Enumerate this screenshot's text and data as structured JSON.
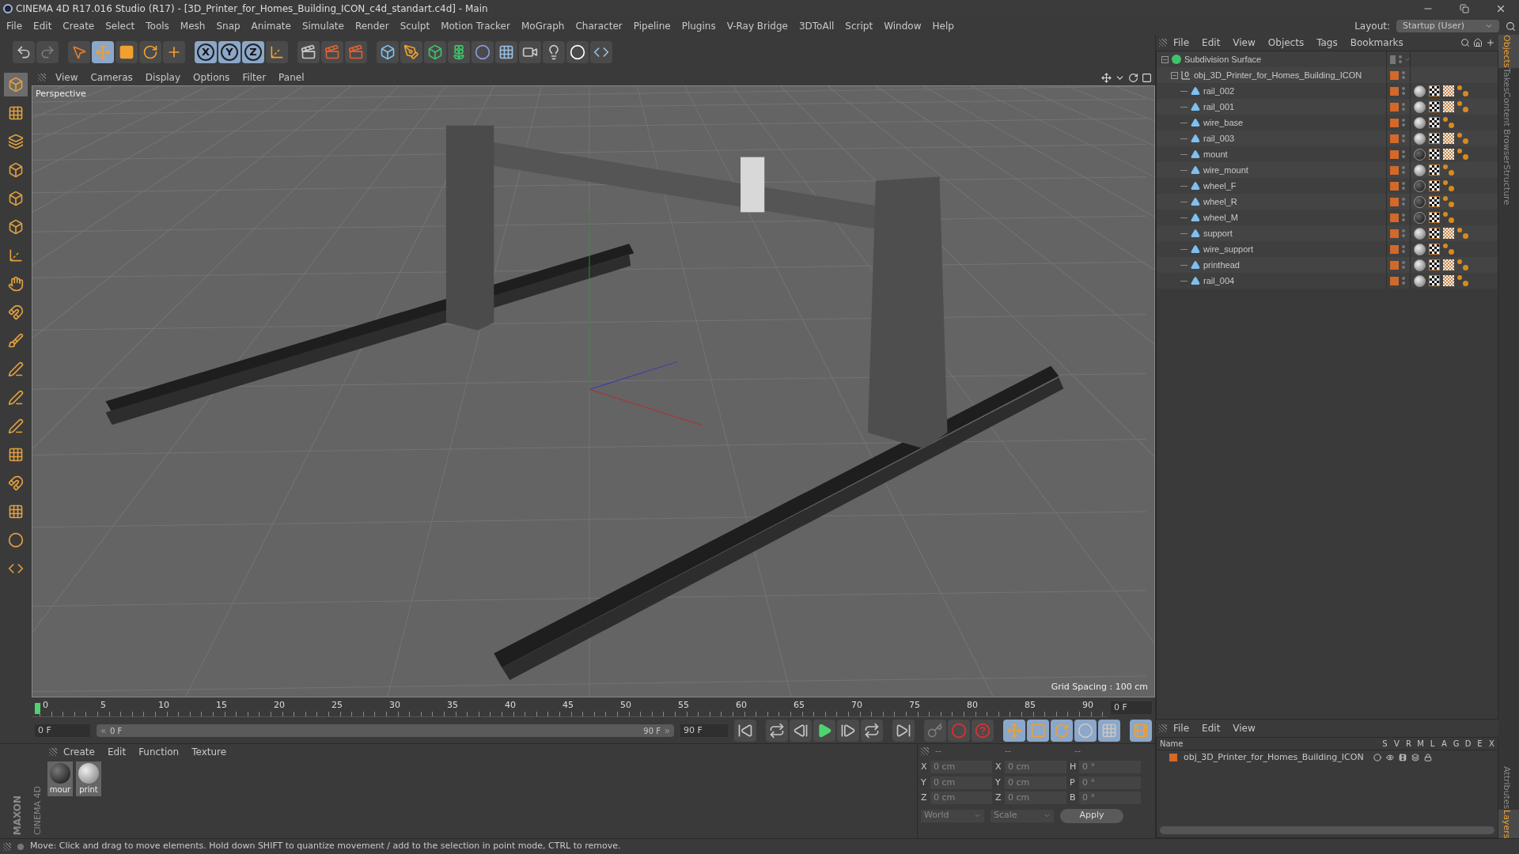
{
  "window": {
    "title": "CINEMA 4D R17.016 Studio (R17) - [3D_Printer_for_Homes_Building_ICON_c4d_standart.c4d] - Main"
  },
  "menu": [
    "File",
    "Edit",
    "Create",
    "Select",
    "Tools",
    "Mesh",
    "Snap",
    "Animate",
    "Simulate",
    "Render",
    "Sculpt",
    "Motion Tracker",
    "MoGraph",
    "Character",
    "Pipeline",
    "Plugins",
    "V-Ray Bridge",
    "3DToAll",
    "Script",
    "Window",
    "Help"
  ],
  "layout": {
    "label": "Layout:",
    "value": "Startup (User)"
  },
  "toolbar": {
    "axes": [
      {
        "label": "X",
        "selected": true
      },
      {
        "label": "Y",
        "selected": true
      },
      {
        "label": "Z",
        "selected": true
      }
    ],
    "move_selected": true
  },
  "viewport": {
    "menu": [
      "View",
      "Cameras",
      "Display",
      "Options",
      "Filter",
      "Panel"
    ],
    "camera": "Perspective",
    "grid_spacing": "Grid Spacing : 100 cm"
  },
  "timeline": {
    "ruler": [
      "0",
      "5",
      "10",
      "15",
      "20",
      "25",
      "30",
      "35",
      "40",
      "45",
      "50",
      "55",
      "60",
      "65",
      "70",
      "75",
      "80",
      "85",
      "90"
    ],
    "current": "0 F",
    "start": "0 F",
    "range_start": "0 F",
    "range_end": "90 F",
    "end": "90 F",
    "range_slider": {
      "level": 1
    }
  },
  "materials": {
    "menu": [
      "Create",
      "Edit",
      "Function",
      "Texture"
    ],
    "items": [
      {
        "label": "mour",
        "dark": true
      },
      {
        "label": "print",
        "dark": false
      }
    ]
  },
  "logo": {
    "brand": "MAXON",
    "product": "CINEMA 4D"
  },
  "coordinates": {
    "headers": [
      "--",
      "--",
      "--"
    ],
    "rows": [
      [
        "X",
        "0 cm",
        "X",
        "0 cm",
        "H",
        "0 °"
      ],
      [
        "Y",
        "0 cm",
        "Y",
        "0 cm",
        "P",
        "0 °"
      ],
      [
        "Z",
        "0 cm",
        "Z",
        "0 cm",
        "B",
        "0 °"
      ]
    ],
    "mode": "World",
    "transform": "Scale",
    "apply": "Apply"
  },
  "objects": {
    "menu": [
      "File",
      "Edit",
      "View",
      "Objects",
      "Tags",
      "Bookmarks"
    ],
    "tree": [
      {
        "name": "Subdivision Surface",
        "kind": "generator",
        "expanded": true,
        "enabled": true,
        "children": [
          {
            "name": "obj_3D_Printer_for_Homes_Building_ICON",
            "kind": "null",
            "expanded": true,
            "children": [
              {
                "name": "rail_002",
                "kind": "polygon",
                "tags": [
                  {
                    "kind": "material",
                    "dark": false
                  },
                  {
                    "kind": "uvw"
                  },
                  {
                    "kind": "pattern"
                  },
                  {
                    "kind": "selection"
                  }
                ]
              },
              {
                "name": "rail_001",
                "kind": "polygon",
                "tags": [
                  {
                    "kind": "material",
                    "dark": false
                  },
                  {
                    "kind": "uvw"
                  },
                  {
                    "kind": "pattern"
                  },
                  {
                    "kind": "selection"
                  }
                ]
              },
              {
                "name": "wire_base",
                "kind": "polygon",
                "tags": [
                  {
                    "kind": "material",
                    "dark": false
                  },
                  {
                    "kind": "uvw"
                  },
                  {
                    "kind": "selection"
                  }
                ]
              },
              {
                "name": "rail_003",
                "kind": "polygon",
                "tags": [
                  {
                    "kind": "material",
                    "dark": false
                  },
                  {
                    "kind": "uvw"
                  },
                  {
                    "kind": "pattern"
                  },
                  {
                    "kind": "selection"
                  }
                ]
              },
              {
                "name": "mount",
                "kind": "polygon",
                "tags": [
                  {
                    "kind": "material",
                    "dark": true
                  },
                  {
                    "kind": "uvw"
                  },
                  {
                    "kind": "pattern"
                  },
                  {
                    "kind": "selection"
                  }
                ]
              },
              {
                "name": "wire_mount",
                "kind": "polygon",
                "tags": [
                  {
                    "kind": "material",
                    "dark": false
                  },
                  {
                    "kind": "uvw"
                  },
                  {
                    "kind": "selection"
                  }
                ]
              },
              {
                "name": "wheel_F",
                "kind": "polygon",
                "tags": [
                  {
                    "kind": "material",
                    "dark": true
                  },
                  {
                    "kind": "uvw"
                  },
                  {
                    "kind": "selection"
                  }
                ]
              },
              {
                "name": "wheel_R",
                "kind": "polygon",
                "tags": [
                  {
                    "kind": "material",
                    "dark": true
                  },
                  {
                    "kind": "uvw"
                  },
                  {
                    "kind": "selection"
                  }
                ]
              },
              {
                "name": "wheel_M",
                "kind": "polygon",
                "tags": [
                  {
                    "kind": "material",
                    "dark": true
                  },
                  {
                    "kind": "uvw"
                  },
                  {
                    "kind": "selection"
                  }
                ]
              },
              {
                "name": "support",
                "kind": "polygon",
                "tags": [
                  {
                    "kind": "material",
                    "dark": false
                  },
                  {
                    "kind": "uvw"
                  },
                  {
                    "kind": "pattern"
                  },
                  {
                    "kind": "selection"
                  }
                ]
              },
              {
                "name": "wire_support",
                "kind": "polygon",
                "tags": [
                  {
                    "kind": "material",
                    "dark": false
                  },
                  {
                    "kind": "uvw"
                  },
                  {
                    "kind": "selection"
                  }
                ]
              },
              {
                "name": "printhead",
                "kind": "polygon",
                "tags": [
                  {
                    "kind": "material",
                    "dark": false
                  },
                  {
                    "kind": "uvw"
                  },
                  {
                    "kind": "pattern"
                  },
                  {
                    "kind": "selection"
                  }
                ]
              },
              {
                "name": "rail_004",
                "kind": "polygon",
                "tags": [
                  {
                    "kind": "material",
                    "dark": false
                  },
                  {
                    "kind": "uvw"
                  },
                  {
                    "kind": "pattern"
                  },
                  {
                    "kind": "selection"
                  }
                ]
              }
            ]
          }
        ]
      }
    ]
  },
  "layers": {
    "menu": [
      "File",
      "Edit",
      "View"
    ],
    "columns": [
      "Name",
      "S",
      "V",
      "R",
      "M",
      "L",
      "A",
      "G",
      "D",
      "E",
      "X"
    ],
    "rows": [
      {
        "name": "obj_3D_Printer_for_Homes_Building_ICON",
        "color": "#d2682a"
      }
    ]
  },
  "side_tabs": [
    {
      "label": "Objects",
      "selected": true
    },
    {
      "label": "Takes",
      "selected": false
    },
    {
      "label": "Content Browser",
      "selected": false
    },
    {
      "label": "Structure",
      "selected": false
    }
  ],
  "bottom_side_tabs": [
    {
      "label": "Attributes",
      "selected": false
    },
    {
      "label": "Layers",
      "selected": true
    }
  ],
  "status_bar": "Move: Click and drag to move elements. Hold down SHIFT to quantize movement / add to the selection in point mode, CTRL to remove."
}
